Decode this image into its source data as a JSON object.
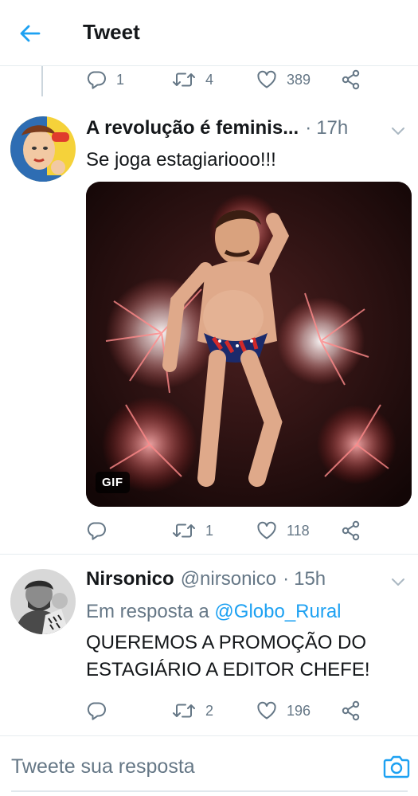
{
  "header": {
    "title": "Tweet"
  },
  "parent_tweet_actions": {
    "reply_count": "1",
    "retweet_count": "4",
    "like_count": "389"
  },
  "tweets": [
    {
      "display_name": "A revolução é feminis...",
      "separator": "·",
      "time": "17h",
      "text": "Se joga estagiariooo!!!",
      "media_badge": "GIF",
      "reply_count": "",
      "retweet_count": "1",
      "like_count": "118"
    },
    {
      "display_name": "Nirsonico",
      "handle": "@nirsonico",
      "separator": "·",
      "time": "15h",
      "reply_prefix": "Em resposta a",
      "reply_mention": "@Globo_Rural",
      "text_line1": "QUEREMOS A PROMOÇÃO DO",
      "text_line2": "ESTAGIÁRIO A EDITOR CHEFE!",
      "reply_count": "",
      "retweet_count": "2",
      "like_count": "196"
    }
  ],
  "composer": {
    "placeholder": "Tweete sua resposta"
  },
  "colors": {
    "accent": "#1da1f2",
    "text_primary": "#14171a",
    "text_secondary": "#657786",
    "divider": "#e6ecf0"
  },
  "icons": {
    "back": "arrow-left-icon",
    "reply": "reply-bubble-icon",
    "retweet": "retweet-icon",
    "like": "heart-icon",
    "share": "share-icon",
    "caret": "chevron-down-icon",
    "camera": "camera-icon"
  }
}
